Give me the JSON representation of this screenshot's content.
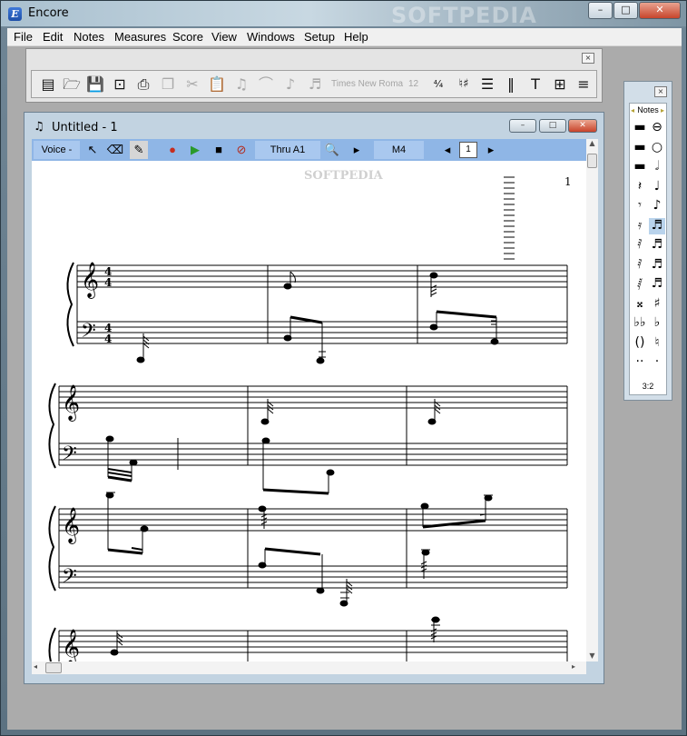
{
  "app": {
    "title": "Encore",
    "logo_letter": "E",
    "watermark": "SOFTPEDIA",
    "window_controls": {
      "minimize": "–",
      "maximize": "□",
      "close": "✕"
    }
  },
  "menubar": [
    "File",
    "Edit",
    "Notes",
    "Measures",
    "Score",
    "View",
    "Windows",
    "Setup",
    "Help"
  ],
  "toolbar": {
    "close": "×",
    "tools": [
      {
        "name": "new-file-icon",
        "glyph": "▤",
        "enabled": true
      },
      {
        "name": "open-folder-icon",
        "glyph": "🗁",
        "enabled": true
      },
      {
        "name": "save-disk-icon",
        "glyph": "💾",
        "enabled": true
      },
      {
        "name": "page-setup-icon",
        "glyph": "⊡",
        "enabled": true
      },
      {
        "name": "print-icon",
        "glyph": "⎙",
        "enabled": true
      },
      {
        "name": "copy-icon",
        "glyph": "❐",
        "enabled": false
      },
      {
        "name": "cut-icon",
        "glyph": "✂",
        "enabled": false
      },
      {
        "name": "paste-icon",
        "glyph": "📋",
        "enabled": false
      },
      {
        "name": "tie-icon",
        "glyph": "♫",
        "enabled": false
      },
      {
        "name": "slur-icon",
        "glyph": "⌒",
        "enabled": false
      },
      {
        "name": "flip-stem-icon",
        "glyph": "♪",
        "enabled": false
      },
      {
        "name": "triplet-icon",
        "glyph": "♬",
        "enabled": false
      },
      {
        "name": "time-signature-icon",
        "glyph": "⁴⁄₄",
        "enabled": true
      },
      {
        "name": "key-signature-icon",
        "glyph": "♮♯",
        "enabled": true
      },
      {
        "name": "staves-icon",
        "glyph": "☰",
        "enabled": true
      },
      {
        "name": "barlines-icon",
        "glyph": "‖",
        "enabled": true
      },
      {
        "name": "text-icon",
        "glyph": "T",
        "enabled": true
      },
      {
        "name": "insert-page-icon",
        "glyph": "⊞",
        "enabled": true
      },
      {
        "name": "add-staff-icon",
        "glyph": "≡",
        "enabled": true
      }
    ],
    "font_name": "Times New Roma",
    "font_size": "12"
  },
  "notes_palette": {
    "title": "Notes",
    "close": "×",
    "left_arrow": "◂",
    "right_arrow": "▸",
    "footer": "3:2",
    "cells": [
      "▬",
      "⊖",
      "▬",
      "○",
      "▬",
      "𝅗𝅥",
      "𝄽",
      "♩",
      "𝄾",
      "♪",
      "𝄿",
      "♬",
      "𝅀",
      "♬",
      "𝅀",
      "♬",
      "𝅁",
      "♬",
      "𝄪",
      "♯",
      "♭♭",
      "♭",
      "()",
      "♮",
      "··",
      "·"
    ],
    "selected_index": 11
  },
  "document": {
    "title": "Untitled - 1",
    "title_icon": "♫",
    "watermark": "SOFTPEDIA",
    "toolbar": {
      "voice": "Voice -",
      "playback_range": "Thru A1",
      "measure": "M4",
      "page_indicator": "1"
    },
    "page_number": "1"
  }
}
